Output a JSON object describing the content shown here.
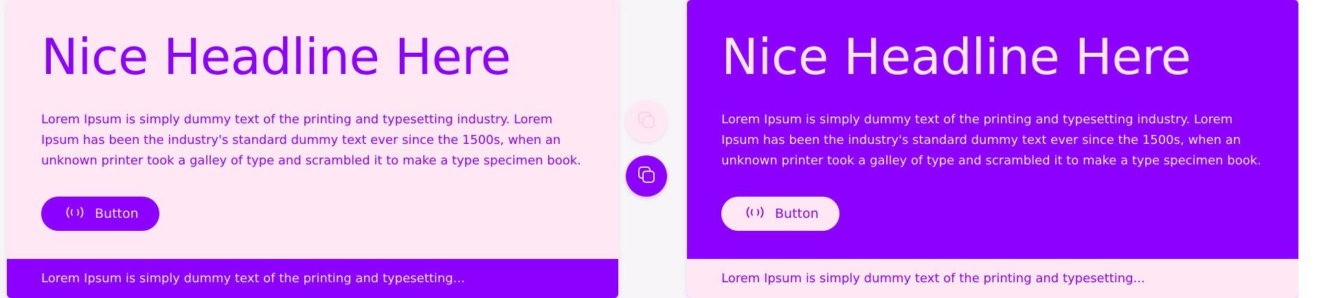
{
  "colors": {
    "accent": "#8b00ff",
    "soft": "#ffe8f4"
  },
  "cards": [
    {
      "variant": "light",
      "headline": "Nice Headline Here",
      "body": "Lorem Ipsum is simply dummy text of the printing and typesetting industry. Lorem Ipsum has been the industry's standard dummy text ever since the 1500s, when an unknown printer took a galley of type and scrambled it to make a type specimen book.",
      "button_label": "Button",
      "button_icon": "broadcast-icon",
      "footer": "Lorem Ipsum is simply dummy text of the printing and typesetting..."
    },
    {
      "variant": "dark",
      "headline": "Nice Headline Here",
      "body": "Lorem Ipsum is simply dummy text of the printing and typesetting industry. Lorem Ipsum has been the industry's standard dummy text ever since the 1500s, when an unknown printer took a galley of type and scrambled it to make a type specimen book.",
      "button_label": "Button",
      "button_icon": "broadcast-icon",
      "footer": "Lorem Ipsum is simply dummy text of the printing and typesetting..."
    }
  ],
  "copy_buttons": [
    {
      "variant": "light",
      "icon": "copy-icon"
    },
    {
      "variant": "dark",
      "icon": "copy-icon"
    }
  ]
}
